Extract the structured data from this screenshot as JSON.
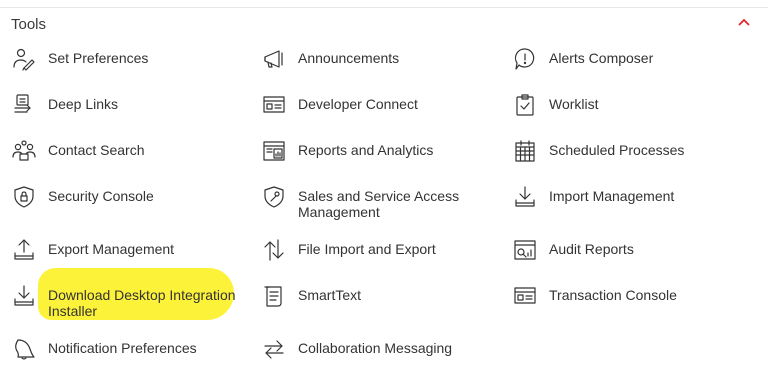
{
  "section": {
    "title": "Tools",
    "collapse_icon": "chevron-up-icon",
    "accent_color": "#e0262a"
  },
  "highlight_color": "#fdf23a",
  "tools": [
    {
      "label": "Set Preferences",
      "icon": "person-preferences-icon"
    },
    {
      "label": "Announcements",
      "icon": "megaphone-icon"
    },
    {
      "label": "Alerts Composer",
      "icon": "alert-bubble-icon"
    },
    {
      "label": "Deep Links",
      "icon": "deep-links-icon"
    },
    {
      "label": "Developer Connect",
      "icon": "developer-connect-icon"
    },
    {
      "label": "Worklist",
      "icon": "clipboard-check-icon"
    },
    {
      "label": "Contact Search",
      "icon": "people-search-icon"
    },
    {
      "label": "Reports and Analytics",
      "icon": "report-chart-icon"
    },
    {
      "label": "Scheduled Processes",
      "icon": "calendar-grid-icon"
    },
    {
      "label": "Security Console",
      "icon": "shield-lock-icon"
    },
    {
      "label": "Sales and Service Access Management",
      "icon": "shield-wrench-icon"
    },
    {
      "label": "Import Management",
      "icon": "import-tray-icon"
    },
    {
      "label": "Export Management",
      "icon": "export-tray-icon"
    },
    {
      "label": "File Import and Export",
      "icon": "up-down-arrows-icon"
    },
    {
      "label": "Audit Reports",
      "icon": "audit-report-icon"
    },
    {
      "label": "Download Desktop Integration Installer",
      "icon": "download-tray-icon"
    },
    {
      "label": "SmartText",
      "icon": "document-lines-icon"
    },
    {
      "label": "Transaction Console",
      "icon": "transaction-console-icon"
    },
    {
      "label": "Notification Preferences",
      "icon": "bell-icon"
    },
    {
      "label": "Collaboration Messaging",
      "icon": "exchange-arrows-icon"
    }
  ]
}
